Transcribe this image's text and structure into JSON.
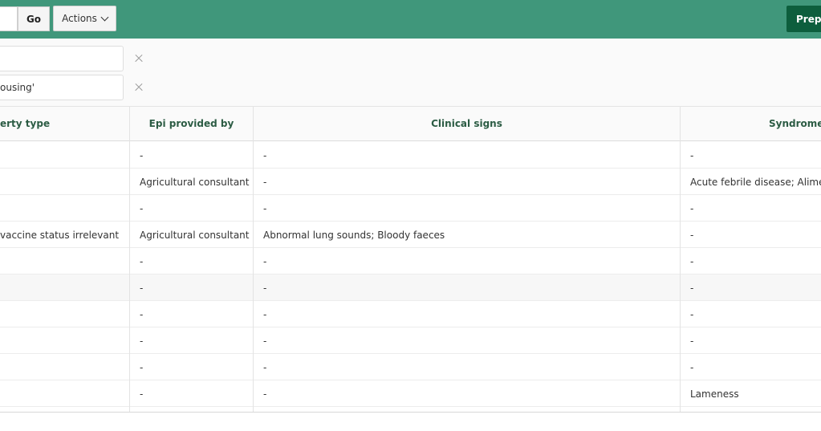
{
  "toolbar": {
    "go_label": "Go",
    "actions_label": "Actions",
    "prepare_label": "Prepa"
  },
  "filters": [
    {
      "text": ""
    },
    {
      "text": "ousing'"
    }
  ],
  "columns": [
    "erty type",
    "Epi provided by",
    "Clinical signs",
    "Syndromes"
  ],
  "rows": [
    [
      "",
      "-",
      "-",
      "-"
    ],
    [
      "",
      "Agricultural consultant",
      "-",
      "Acute febrile disease; Alimenta"
    ],
    [
      "",
      "-",
      "-",
      "-"
    ],
    [
      "vaccine status irrelevant",
      "Agricultural consultant",
      "Abnormal lung sounds; Bloody faeces",
      "-"
    ],
    [
      "",
      "-",
      "-",
      "-"
    ],
    [
      "",
      "-",
      "-",
      "-"
    ],
    [
      "",
      "-",
      "-",
      "-"
    ],
    [
      "",
      "-",
      "-",
      "-"
    ],
    [
      "",
      "-",
      "-",
      "-"
    ],
    [
      "",
      "-",
      "-",
      "Lameness"
    ]
  ],
  "colors": {
    "toolbar": "#40977b",
    "primary_button": "#0d5e3d",
    "header_text": "#2c5c44"
  }
}
